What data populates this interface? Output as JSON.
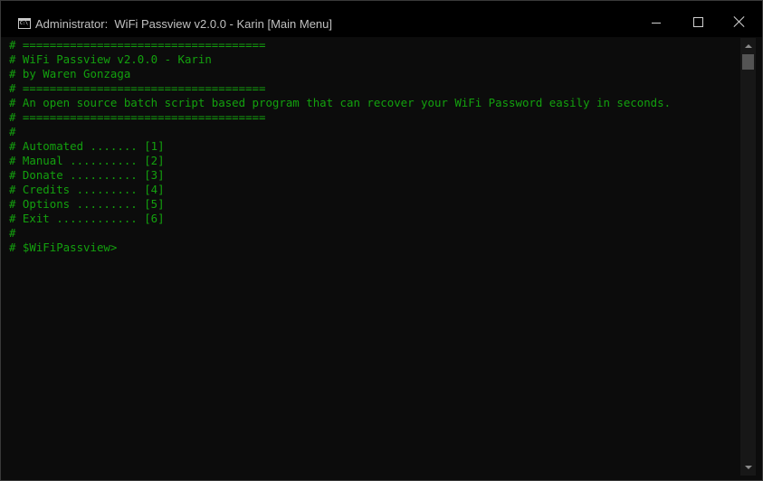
{
  "window": {
    "title": "Administrator:  WiFi Passview v2.0.0 - Karin [Main Menu]"
  },
  "colors": {
    "console_text": "#13a10e",
    "console_background": "#0c0c0c",
    "titlebar_background": "#000000"
  },
  "icons": {
    "app": "cmd-icon",
    "minimize": "minimize-icon",
    "maximize": "maximize-icon",
    "close": "close-icon",
    "scroll_up": "arrow-up-icon",
    "scroll_down": "arrow-down-icon"
  },
  "console": {
    "lines": [
      "# ====================================",
      "# WiFi Passview v2.0.0 - Karin",
      "# by Waren Gonzaga",
      "# ====================================",
      "# An open source batch script based program that can recover your WiFi Password easily in seconds.",
      "# ====================================",
      "#",
      "# Automated ....... [1]",
      "# Manual .......... [2]",
      "# Donate .......... [3]",
      "# Credits ......... [4]",
      "# Options ......... [5]",
      "# Exit ............ [6]",
      "#",
      "# $WiFiPassview>"
    ]
  }
}
